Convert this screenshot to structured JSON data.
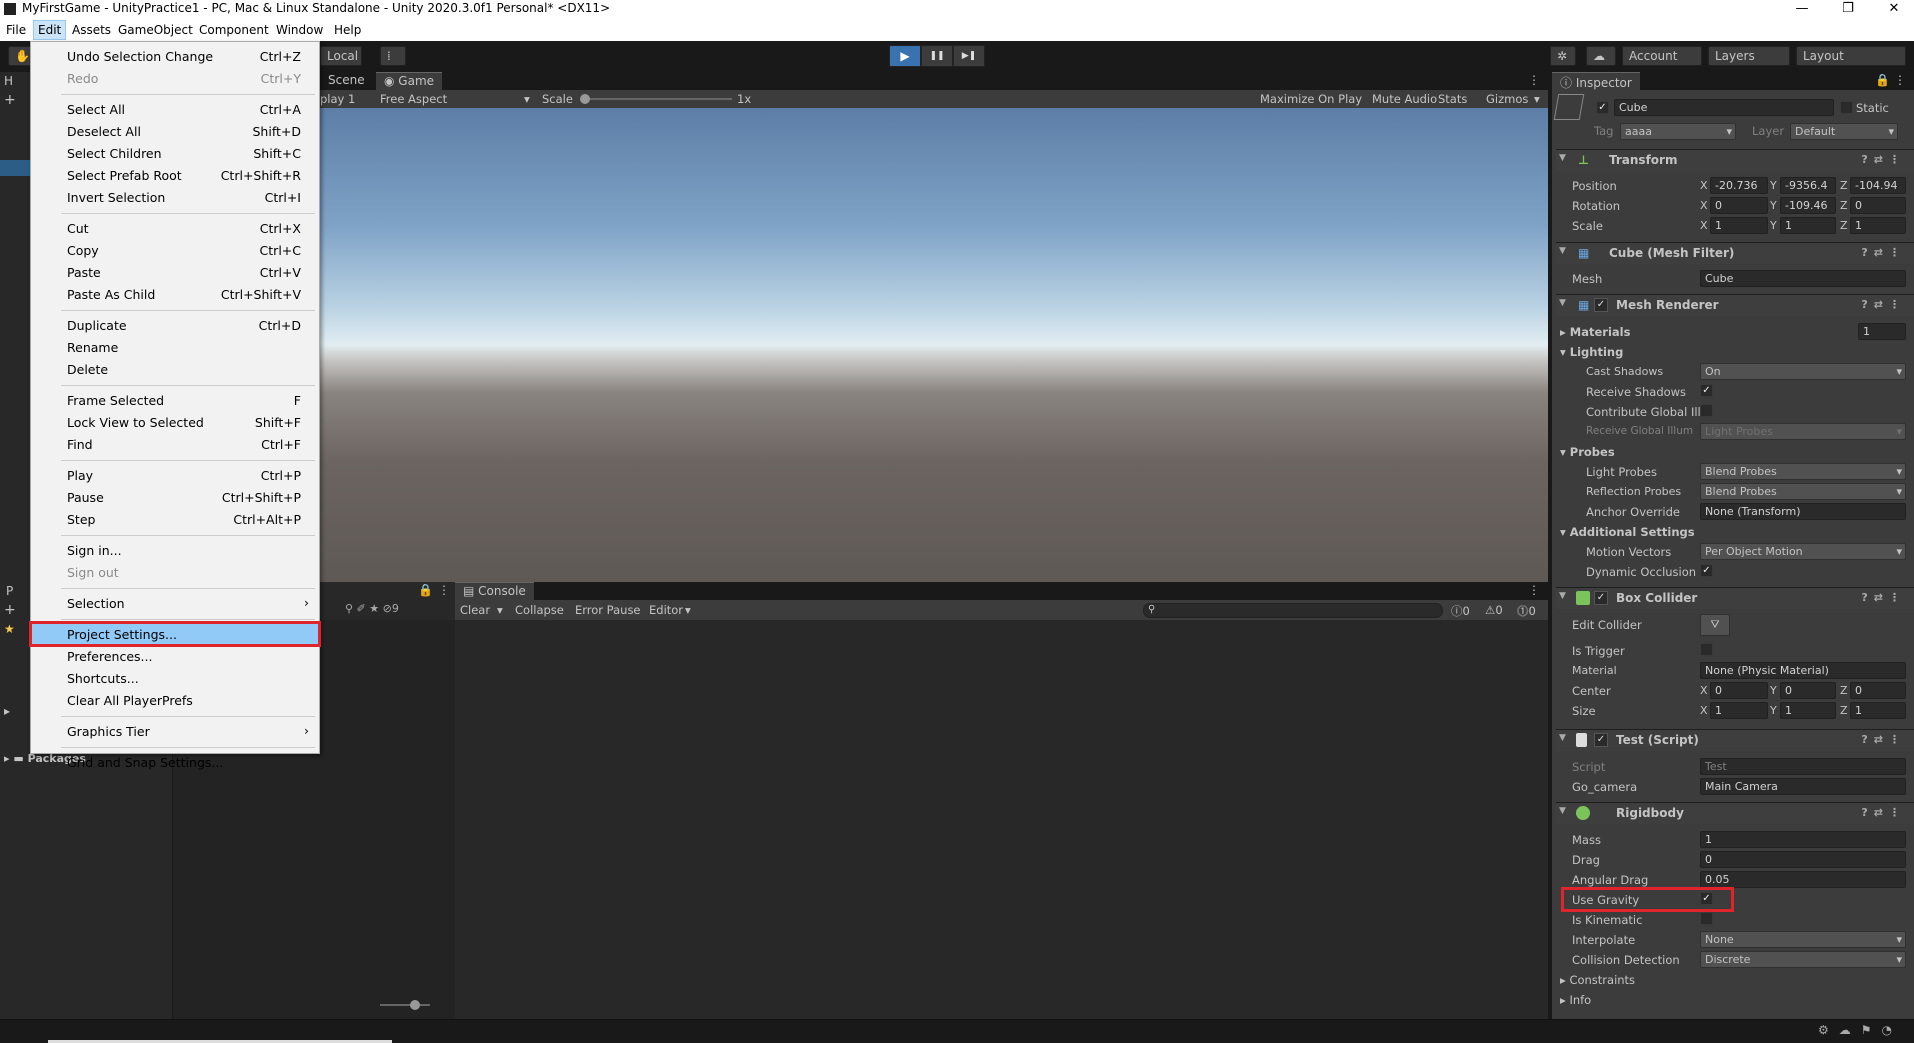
{
  "window": {
    "title": "MyFirstGame - UnityPractice1 - PC, Mac & Linux Standalone - Unity 2020.3.0f1 Personal* <DX11>"
  },
  "menubar": [
    "File",
    "Edit",
    "Assets",
    "GameObject",
    "Component",
    "Window",
    "Help"
  ],
  "toolbar": {
    "local": "Local",
    "account": "Account",
    "layers": "Layers",
    "layout": "Layout",
    "play": "▶",
    "pause": "❚❚",
    "step": "▶❚"
  },
  "game_view": {
    "tab_scene": "Scene",
    "tab_game": "Game",
    "display": "play 1",
    "aspect": "Free Aspect",
    "scale_label": "Scale",
    "scale_value": "1x",
    "maximize": "Maximize On Play",
    "mute": "Mute Audio",
    "stats": "Stats",
    "gizmos": "Gizmos"
  },
  "left_panels": {
    "hierarchy_tab": "H",
    "project_tab": "P",
    "packages": "Packages",
    "hidden_count": "9"
  },
  "console": {
    "tab": "Console",
    "clear": "Clear",
    "collapse": "Collapse",
    "error_pause": "Error Pause",
    "editor": "Editor",
    "count_log": "0",
    "count_warn": "0",
    "count_err": "0"
  },
  "edit_menu": [
    {
      "label": "Undo Selection Change",
      "shortcut": "Ctrl+Z"
    },
    {
      "label": "Redo",
      "shortcut": "Ctrl+Y",
      "disabled": true
    },
    {
      "sep": true
    },
    {
      "label": "Select All",
      "shortcut": "Ctrl+A"
    },
    {
      "label": "Deselect All",
      "shortcut": "Shift+D"
    },
    {
      "label": "Select Children",
      "shortcut": "Shift+C"
    },
    {
      "label": "Select Prefab Root",
      "shortcut": "Ctrl+Shift+R"
    },
    {
      "label": "Invert Selection",
      "shortcut": "Ctrl+I"
    },
    {
      "sep": true
    },
    {
      "label": "Cut",
      "shortcut": "Ctrl+X"
    },
    {
      "label": "Copy",
      "shortcut": "Ctrl+C"
    },
    {
      "label": "Paste",
      "shortcut": "Ctrl+V"
    },
    {
      "label": "Paste As Child",
      "shortcut": "Ctrl+Shift+V"
    },
    {
      "sep": true
    },
    {
      "label": "Duplicate",
      "shortcut": "Ctrl+D"
    },
    {
      "label": "Rename",
      "shortcut": ""
    },
    {
      "label": "Delete",
      "shortcut": ""
    },
    {
      "sep": true
    },
    {
      "label": "Frame Selected",
      "shortcut": "F"
    },
    {
      "label": "Lock View to Selected",
      "shortcut": "Shift+F"
    },
    {
      "label": "Find",
      "shortcut": "Ctrl+F"
    },
    {
      "sep": true
    },
    {
      "label": "Play",
      "shortcut": "Ctrl+P"
    },
    {
      "label": "Pause",
      "shortcut": "Ctrl+Shift+P"
    },
    {
      "label": "Step",
      "shortcut": "Ctrl+Alt+P"
    },
    {
      "sep": true
    },
    {
      "label": "Sign in...",
      "shortcut": ""
    },
    {
      "label": "Sign out",
      "shortcut": "",
      "disabled": true
    },
    {
      "sep": true
    },
    {
      "label": "Selection",
      "shortcut": "",
      "submenu": true
    },
    {
      "sep": true
    },
    {
      "label": "Project Settings...",
      "shortcut": "",
      "highlighted": true
    },
    {
      "label": "Preferences...",
      "shortcut": ""
    },
    {
      "label": "Shortcuts...",
      "shortcut": ""
    },
    {
      "label": "Clear All PlayerPrefs",
      "shortcut": ""
    },
    {
      "sep": true
    },
    {
      "label": "Graphics Tier",
      "shortcut": "",
      "submenu": true
    },
    {
      "sep": true
    },
    {
      "label": "Grid and Snap Settings...",
      "shortcut": ""
    }
  ],
  "inspector": {
    "tab": "Inspector",
    "object_name": "Cube",
    "static_label": "Static",
    "tag_label": "Tag",
    "tag_value": "aaaa",
    "layer_label": "Layer",
    "layer_value": "Default",
    "transform": {
      "title": "Transform",
      "position_label": "Position",
      "rotation_label": "Rotation",
      "scale_label": "Scale",
      "pos": [
        "-20.736",
        "-9356.4",
        "-104.94"
      ],
      "rot": [
        "0",
        "-109.46",
        "0"
      ],
      "scl": [
        "1",
        "1",
        "1"
      ]
    },
    "mesh_filter": {
      "title": "Cube (Mesh Filter)",
      "mesh_label": "Mesh",
      "mesh_value": "Cube"
    },
    "mesh_renderer": {
      "title": "Mesh Renderer",
      "materials_label": "Materials",
      "materials_count": "1",
      "lighting_label": "Lighting",
      "cast_shadows_label": "Cast Shadows",
      "cast_shadows_value": "On",
      "receive_shadows_label": "Receive Shadows",
      "contribute_gi_label": "Contribute Global Ill",
      "receive_gi_label": "Receive Global Illum",
      "receive_gi_value": "Light Probes",
      "probes_label": "Probes",
      "light_probes_label": "Light Probes",
      "light_probes_value": "Blend Probes",
      "reflection_probes_label": "Reflection Probes",
      "reflection_probes_value": "Blend Probes",
      "anchor_override_label": "Anchor Override",
      "anchor_override_value": "None (Transform)",
      "additional_label": "Additional Settings",
      "motion_vectors_label": "Motion Vectors",
      "motion_vectors_value": "Per Object Motion",
      "dynamic_occlusion_label": "Dynamic Occlusion"
    },
    "box_collider": {
      "title": "Box Collider",
      "edit_collider_label": "Edit Collider",
      "is_trigger_label": "Is Trigger",
      "material_label": "Material",
      "material_value": "None (Physic Material)",
      "center_label": "Center",
      "center": [
        "0",
        "0",
        "0"
      ],
      "size_label": "Size",
      "size": [
        "1",
        "1",
        "1"
      ]
    },
    "test_script": {
      "title": "Test (Script)",
      "script_label": "Script",
      "script_value": "Test",
      "go_camera_label": "Go_camera",
      "go_camera_value": "Main Camera"
    },
    "rigidbody": {
      "title": "Rigidbody",
      "mass_label": "Mass",
      "mass": "1",
      "drag_label": "Drag",
      "drag": "0",
      "angular_drag_label": "Angular Drag",
      "angular_drag": "0.05",
      "use_gravity_label": "Use Gravity",
      "is_kinematic_label": "Is Kinematic",
      "interpolate_label": "Interpolate",
      "interpolate_value": "None",
      "collision_label": "Collision Detection",
      "collision_value": "Discrete",
      "constraints_label": "Constraints",
      "info_label": "Info"
    },
    "axis": [
      "X",
      "Y",
      "Z"
    ]
  },
  "colors": {
    "highlight_box": "#e0242c",
    "menu_highlight": "#91c9f7"
  }
}
